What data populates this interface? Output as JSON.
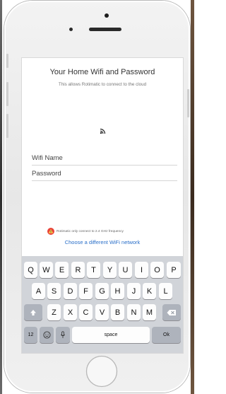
{
  "screen": {
    "title": "Your Home Wifi and Password",
    "subtitle": "This allows Rotimatic to connect to the cloud",
    "wifi_name_placeholder": "Wifi Name",
    "password_placeholder": "Password",
    "frequency_note": "Rotimatic only connect to 2.4 GHz frequency",
    "change_network_link": "Choose a different WiFi network"
  },
  "keyboard": {
    "row1": [
      "Q",
      "W",
      "E",
      "R",
      "T",
      "Y",
      "U",
      "I",
      "O",
      "P"
    ],
    "row2": [
      "A",
      "S",
      "D",
      "F",
      "G",
      "H",
      "J",
      "K",
      "L"
    ],
    "row3": [
      "Z",
      "X",
      "C",
      "V",
      "B",
      "N",
      "M"
    ],
    "numbers_key": "12",
    "space_key": "space",
    "ok_key": "Ok"
  },
  "icons": {
    "wifi_status": "wifi-icon",
    "warning": "warning-icon",
    "shift": "shift-icon",
    "backspace": "backspace-icon",
    "emoji": "emoji-icon",
    "microphone": "microphone-icon"
  },
  "colors": {
    "link": "#2a6fc9",
    "warning": "#e8433a",
    "keyboard_bg": "#d1d4d9"
  }
}
